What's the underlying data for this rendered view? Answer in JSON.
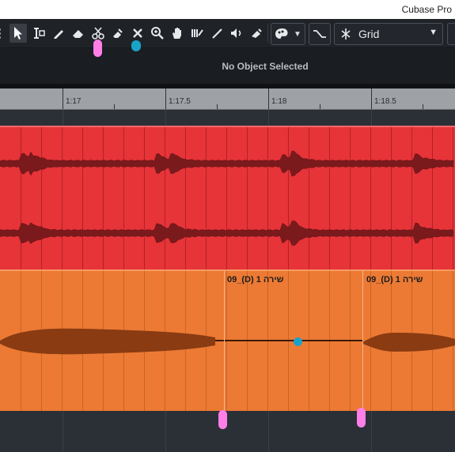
{
  "window": {
    "title": "Cubase Pro"
  },
  "toolbar": {
    "tools": [
      {
        "name": "menu-icon",
        "glyph": "≡"
      },
      {
        "name": "object-select-icon",
        "glyph": "➤"
      },
      {
        "name": "range-select-icon",
        "glyph": "I"
      },
      {
        "name": "draw-icon",
        "glyph": "✎"
      },
      {
        "name": "erase-icon",
        "glyph": "⌫"
      },
      {
        "name": "split-scissors-icon",
        "glyph": "✂"
      },
      {
        "name": "glue-icon",
        "glyph": "⬊"
      },
      {
        "name": "mute-x-icon",
        "glyph": "✕"
      },
      {
        "name": "zoom-icon",
        "glyph": "⊕"
      },
      {
        "name": "hand-icon",
        "glyph": "✋"
      },
      {
        "name": "time-warp-icon",
        "glyph": "‖"
      },
      {
        "name": "line-icon",
        "glyph": "/"
      },
      {
        "name": "play-speaker-icon",
        "glyph": "◀"
      },
      {
        "name": "color-icon",
        "glyph": "⬋"
      }
    ],
    "snap_label": "Grid",
    "colors_menu_icon": "palette-icon"
  },
  "infoline": {
    "text": "No Object Selected"
  },
  "ruler": {
    "labels": [
      "1:17",
      "1:17.5",
      "1:18",
      "1:18.5"
    ]
  },
  "tracks": {
    "orange": {
      "events": [
        {
          "label": "09_(D) שירה 1"
        },
        {
          "label": "09_(D) שירה 1"
        }
      ]
    }
  },
  "colors": {
    "red_track": "#e63439",
    "orange_track": "#ec7a34",
    "marker_pink": "#ff7ee8",
    "marker_blue": "#1aa3c8"
  }
}
